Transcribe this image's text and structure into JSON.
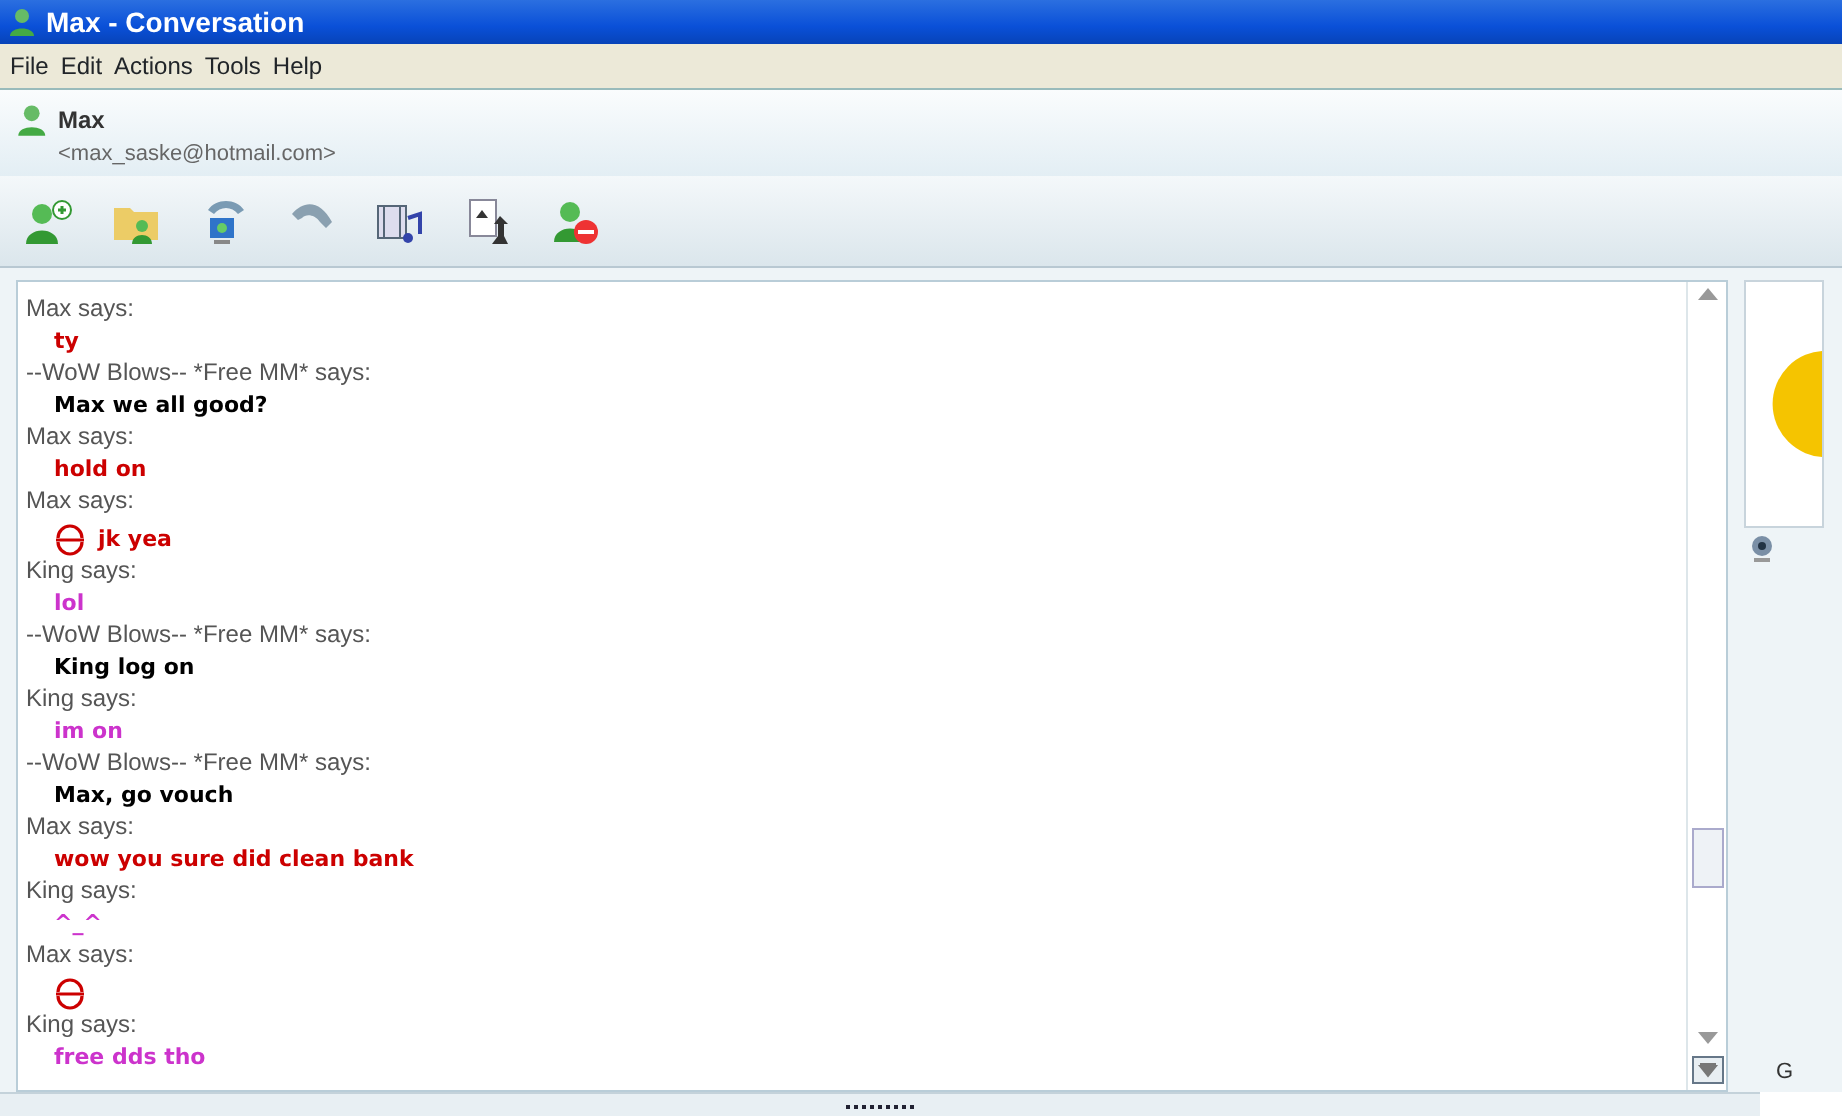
{
  "window": {
    "title": "Max - Conversation"
  },
  "menu": [
    "File",
    "Edit",
    "Actions",
    "Tools",
    "Help"
  ],
  "contact": {
    "name": "Max",
    "email": "<max_saske@hotmail.com>"
  },
  "messages": [
    {
      "sender": "Max says:",
      "text": "ty",
      "color": "#cc0000",
      "emoticon": false
    },
    {
      "sender": "--WoW Blows-- *Free MM* says:",
      "text": "Max we all good?",
      "color": "#000000",
      "emoticon": false
    },
    {
      "sender": "Max says:",
      "text": "hold on",
      "color": "#cc0000",
      "emoticon": false
    },
    {
      "sender": "Max says:",
      "text": "jk yea",
      "color": "#cc0000",
      "emoticon": true
    },
    {
      "sender": "King says:",
      "text": "lol",
      "color": "#cc33cc",
      "emoticon": false
    },
    {
      "sender": "--WoW Blows-- *Free MM* says:",
      "text": "King log on",
      "color": "#000000",
      "emoticon": false
    },
    {
      "sender": "King says:",
      "text": "im on",
      "color": "#cc33cc",
      "emoticon": false
    },
    {
      "sender": "--WoW Blows-- *Free MM* says:",
      "text": "Max, go vouch",
      "color": "#000000",
      "emoticon": false
    },
    {
      "sender": "Max says:",
      "text": "wow you sure did clean bank",
      "color": "#cc0000",
      "emoticon": false
    },
    {
      "sender": "King says:",
      "text": "^_^",
      "color": "#cc33cc",
      "emoticon": false
    },
    {
      "sender": "Max says:",
      "color": "#cc0000",
      "emoticon": true
    },
    {
      "sender": "King says:",
      "text": "free dds tho",
      "color": "#cc33cc",
      "emoticon": false
    }
  ],
  "side_label": "G"
}
